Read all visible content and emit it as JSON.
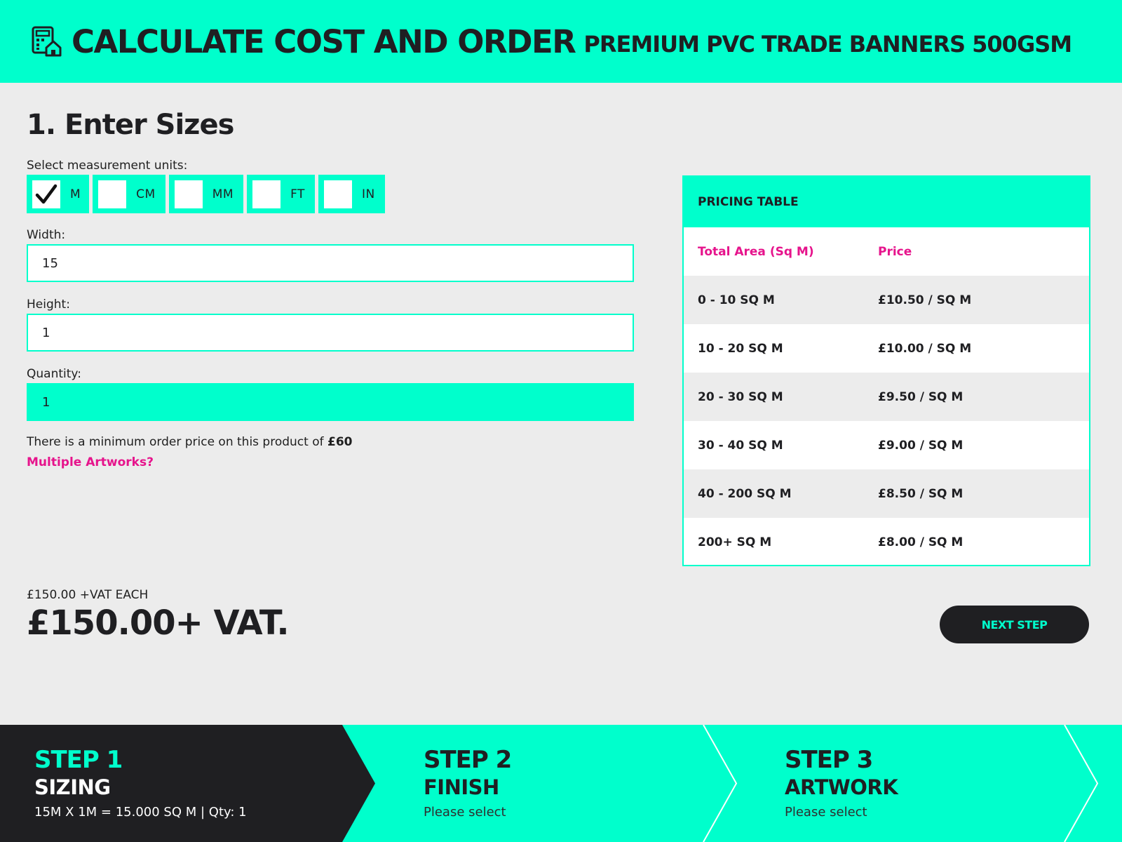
{
  "header": {
    "title": "CALCULATE COST AND ORDER",
    "subtitle": "PREMIUM PVC TRADE BANNERS 500GSM",
    "icon": "calculator-icon"
  },
  "sizes": {
    "section_title": "1. Enter Sizes",
    "units_label": "Select measurement units:",
    "units": [
      {
        "label": "M",
        "checked": true
      },
      {
        "label": "CM",
        "checked": false
      },
      {
        "label": "MM",
        "checked": false
      },
      {
        "label": "FT",
        "checked": false
      },
      {
        "label": "IN",
        "checked": false
      }
    ],
    "width_label": "Width:",
    "width_value": "15",
    "height_label": "Height:",
    "height_value": "1",
    "quantity_label": "Quantity:",
    "quantity_value": "1",
    "min_order_text": "There is a minimum order price on this product of ",
    "min_order_amount": "£60",
    "multiple_artworks_link": "Multiple Artworks?"
  },
  "pricing_table": {
    "title": "PRICING TABLE",
    "col_area": "Total Area (Sq M)",
    "col_price": "Price",
    "rows": [
      {
        "area": "0 - 10 SQ M",
        "price": "£10.50 / SQ M"
      },
      {
        "area": "10 - 20 SQ M",
        "price": "£10.00 / SQ M"
      },
      {
        "area": "20 - 30 SQ M",
        "price": "£9.50 / SQ M"
      },
      {
        "area": "30 - 40 SQ M",
        "price": "£9.00 / SQ M"
      },
      {
        "area": "40 - 200 SQ M",
        "price": "£8.50 / SQ M"
      },
      {
        "area": "200+ SQ M",
        "price": "£8.00 / SQ M"
      }
    ]
  },
  "price": {
    "each": "£150.00 +VAT EACH",
    "total": "£150.00+ VAT."
  },
  "next_button": "NEXT STEP",
  "steps": [
    {
      "number": "STEP 1",
      "name": "SIZING",
      "desc": "15M X 1M = 15.000 SQ M | Qty: 1"
    },
    {
      "number": "STEP 2",
      "name": "FINISH",
      "desc": "Please select"
    },
    {
      "number": "STEP 3",
      "name": "ARTWORK",
      "desc": "Please select"
    }
  ],
  "colors": {
    "accent": "#00ffcc",
    "dark": "#1f1f22",
    "link": "#e6148c",
    "background": "#ececec"
  }
}
